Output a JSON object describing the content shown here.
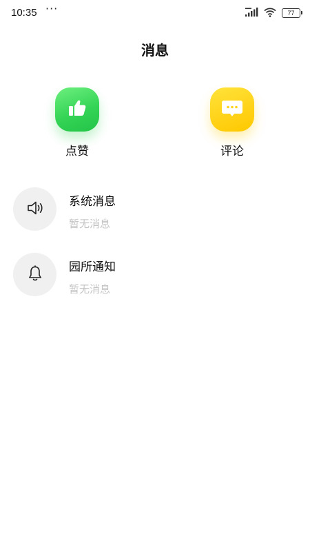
{
  "status_bar": {
    "time": "10:35",
    "dots": "···",
    "battery": "77"
  },
  "header": {
    "title": "消息"
  },
  "quick_actions": [
    {
      "label": "点赞",
      "icon": "thumbs-up-icon",
      "color": "#35d457"
    },
    {
      "label": "评论",
      "icon": "comment-bubble-icon",
      "color": "#ffd31a"
    }
  ],
  "messages": [
    {
      "title": "系统消息",
      "subtitle": "暂无消息",
      "icon": "speaker-icon"
    },
    {
      "title": "园所通知",
      "subtitle": "暂无消息",
      "icon": "bell-icon"
    }
  ]
}
